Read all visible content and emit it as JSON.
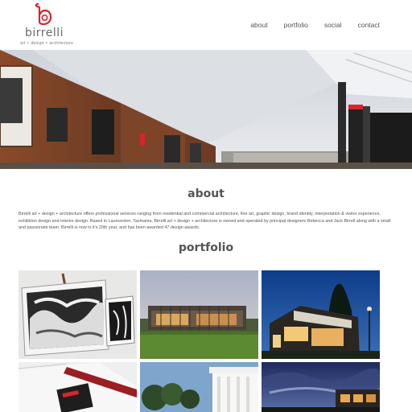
{
  "brand": {
    "name": "birrelli",
    "tagline": "art + design + architecture",
    "logo_icon": "b-logo-icon",
    "accent_color": "#d6262c"
  },
  "nav": {
    "items": [
      {
        "label": "about"
      },
      {
        "label": "portfolio"
      },
      {
        "label": "social"
      },
      {
        "label": "contact"
      }
    ]
  },
  "about": {
    "heading": "about",
    "body": "Birrelli art + design + architecture offers professional services ranging from residential and commercial architecture, fine art, graphic design, brand identity, interpretation & visitor experience, exhibition design and interior design. Based in Launceston, Tasmania, Birrelli art + design + architecture is owned and operated by principal designers Rebecca and Jack Birrell along with a small and passionate team. Birrelli is now in it's 20th year, and has been awarded 47 design awards."
  },
  "portfolio": {
    "heading": "portfolio"
  }
}
